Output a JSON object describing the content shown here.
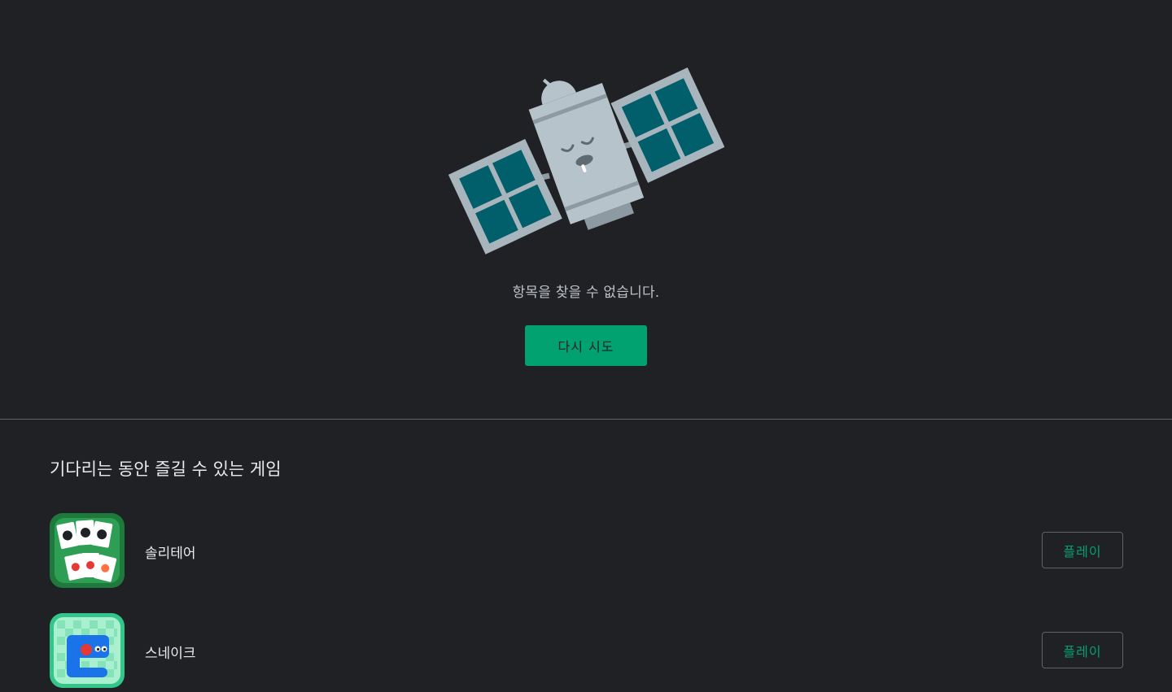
{
  "error": {
    "illustration_icon": "sleeping-satellite-icon",
    "message": "항목을 찾을 수 없습니다.",
    "retry_label": "다시 시도"
  },
  "games": {
    "title": "기다리는 동안 즐길 수 있는 게임",
    "items": [
      {
        "name": "솔리테어",
        "icon": "solitaire-cards-icon",
        "play_label": "플레이"
      },
      {
        "name": "스네이크",
        "icon": "snake-game-icon",
        "play_label": "플레이"
      }
    ]
  },
  "colors": {
    "background": "#202124",
    "accent": "#01a26f",
    "divider": "#5f6368",
    "text_primary": "#e8eaed",
    "text_secondary": "#bdc1c6"
  }
}
